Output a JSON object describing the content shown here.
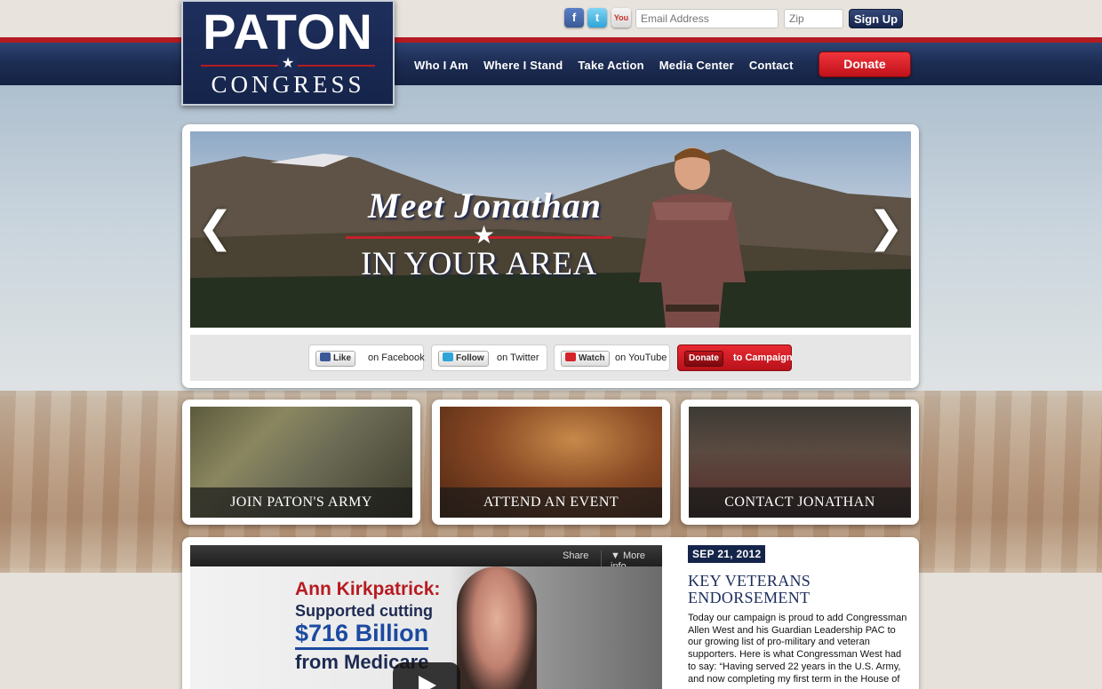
{
  "header": {
    "logo_top": "PATON",
    "logo_bottom": "CONGRESS",
    "social_icons": [
      "facebook-icon",
      "twitter-icon",
      "youtube-icon"
    ],
    "email_placeholder": "Email Address",
    "zip_placeholder": "Zip",
    "signup_label": "Sign Up",
    "nav": [
      "Who I Am",
      "Where I Stand",
      "Take Action",
      "Media Center",
      "Contact"
    ],
    "donate_label": "Donate"
  },
  "hero": {
    "title_line1": "Meet Jonathan",
    "title_line2": "IN YOUR AREA",
    "prev_icon": "chevron-left-icon",
    "next_icon": "chevron-right-icon",
    "buttons": [
      {
        "pill": "Like",
        "text": "on Facebook"
      },
      {
        "pill": "Follow",
        "text": "on Twitter"
      },
      {
        "pill": "Watch",
        "text": "on YouTube"
      },
      {
        "pill": "Donate",
        "text": "to Campaign"
      }
    ]
  },
  "features": [
    {
      "caption": "JOIN PATON'S ARMY"
    },
    {
      "caption": "ATTEND AN EVENT"
    },
    {
      "caption": "CONTACT JONATHAN"
    }
  ],
  "video": {
    "share": "Share",
    "more_info": "More info",
    "line1": "Ann Kirkpatrick:",
    "line2": "Supported cutting",
    "line3": "$716 Billion",
    "line4": "from Medicare"
  },
  "news": {
    "date": "SEP 21, 2012",
    "title": "KEY VETERANS ENDORSEMENT",
    "body": "Today our campaign is proud to add Congressman Allen West and his Guardian Leadership PAC to our growing list of pro-military and veteran supporters. Here is what Congressman West had to say: “Having served 22 years in the U.S. Army, and now completing my first term in the House of"
  },
  "colors": {
    "navy": "#15244a",
    "red": "#b41b22",
    "donate_red": "#d81e26"
  }
}
